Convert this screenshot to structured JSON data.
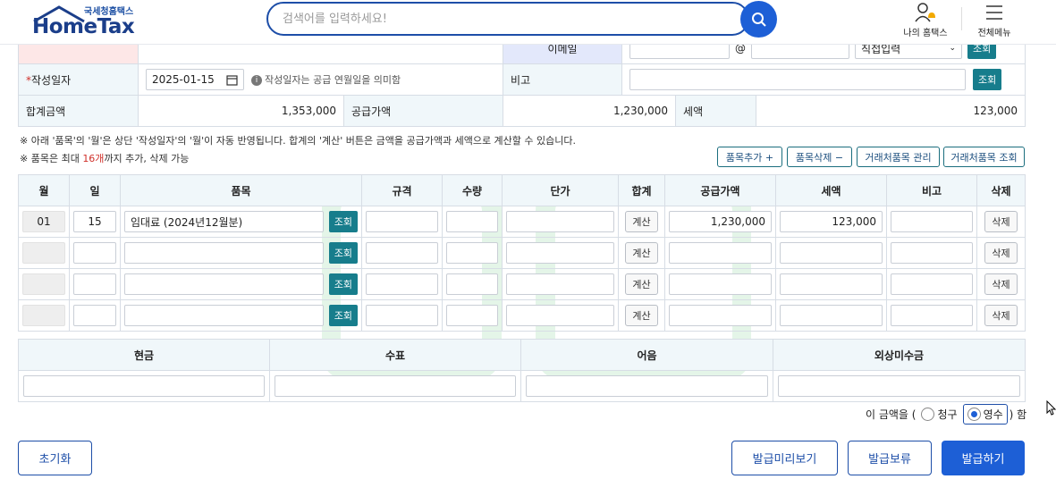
{
  "header": {
    "logo_small": "국세청홈택스",
    "logo_big": "HomeTax",
    "search_placeholder": "검색어를 입력하세요!",
    "my_hometax": "나의 홈택스",
    "full_menu": "전체메뉴"
  },
  "form": {
    "email_label": "이메일",
    "email_at": "@",
    "email_select": "직접입력",
    "lookup": "조회",
    "date_label": "작성일자",
    "date_value": "2025-01-15",
    "date_hint": "작성일자는 공급 연월일을 의미함",
    "remarks_label": "비고",
    "total_label": "합계금액",
    "total_value": "1,353,000",
    "supply_label": "공급가액",
    "supply_value": "1,230,000",
    "tax_label": "세액",
    "tax_value": "123,000"
  },
  "notes": {
    "line1": "※ 아래 '품목'의 '월'은 상단 '작성일자'의 '월'이 자동 반영됩니다. 합계의 '계산' 버튼은 금액을 공급가액과 세액으로 계산할 수 있습니다.",
    "line2_a": "※ 품목은 최대 ",
    "line2_b": "16개",
    "line2_c": "까지 추가, 삭제 가능"
  },
  "item_buttons": {
    "add": "품목추가 +",
    "remove": "품목삭제 −",
    "manage": "거래처품목 관리",
    "lookup": "거래처품목 조회"
  },
  "items": {
    "headers": [
      "월",
      "일",
      "품목",
      "규격",
      "수량",
      "단가",
      "합계",
      "공급가액",
      "세액",
      "비고",
      "삭제"
    ],
    "lookup": "조회",
    "calc": "계산",
    "delete": "삭제",
    "rows": [
      {
        "month": "01",
        "day": "15",
        "name": "임대료 (2024년12월분)",
        "supply": "1,230,000",
        "tax": "123,000"
      },
      {
        "month": "",
        "day": "",
        "name": "",
        "supply": "",
        "tax": ""
      },
      {
        "month": "",
        "day": "",
        "name": "",
        "supply": "",
        "tax": ""
      },
      {
        "month": "",
        "day": "",
        "name": "",
        "supply": "",
        "tax": ""
      }
    ]
  },
  "payment": {
    "headers": [
      "현금",
      "수표",
      "어음",
      "외상미수금"
    ]
  },
  "amount_line": {
    "prefix": "이 금액을 (",
    "opt_claim": "청구",
    "opt_receipt": "영수",
    "suffix": ") 함",
    "selected": "영수"
  },
  "footer": {
    "reset": "초기화",
    "preview": "발급미리보기",
    "hold": "발급보류",
    "issue": "발급하기"
  },
  "colors": {
    "primary": "#1d5fd6",
    "teal": "#177d8c",
    "label_bg": "#f0f7fa"
  }
}
